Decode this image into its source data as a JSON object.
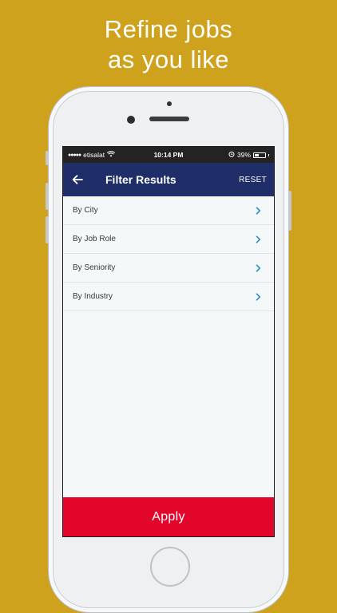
{
  "headline": {
    "line1": "Refine jobs",
    "line2": "as you like"
  },
  "status_bar": {
    "carrier": "etisalat",
    "time": "10:14 PM",
    "battery": "39%",
    "battery_level": 0.39
  },
  "navbar": {
    "title": "Filter Results",
    "reset_label": "RESET"
  },
  "filters": [
    {
      "label": "By City"
    },
    {
      "label": "By Job Role"
    },
    {
      "label": "By Seniority"
    },
    {
      "label": "By Industry"
    }
  ],
  "apply_label": "Apply",
  "colors": {
    "background": "#cfa21d",
    "navbar": "#1f2e68",
    "apply": "#e2062b",
    "chevron": "#2a8fc6"
  }
}
